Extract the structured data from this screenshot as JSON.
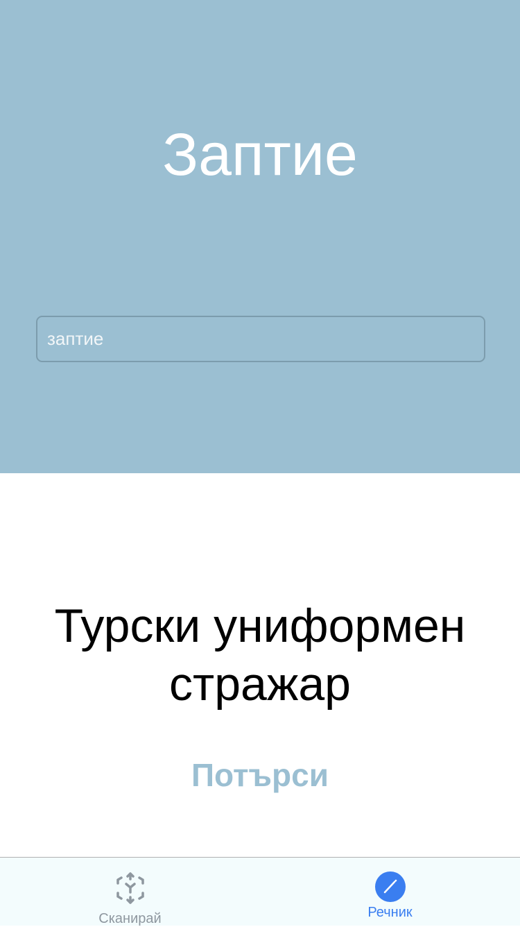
{
  "header": {
    "title": "Заптие"
  },
  "search": {
    "value": "заптие"
  },
  "result": {
    "definition": "Турски униформен стражар"
  },
  "actions": {
    "search_label": "Потърси"
  },
  "tabbar": {
    "tabs": [
      {
        "label": "Сканирай",
        "icon": "ar-cube-icon",
        "active": false
      },
      {
        "label": "Речник",
        "icon": "pencil-icon",
        "active": true
      }
    ]
  },
  "colors": {
    "hero": "#9bbfd2",
    "accent": "#3a7ef0",
    "inactive": "#8e979f"
  }
}
